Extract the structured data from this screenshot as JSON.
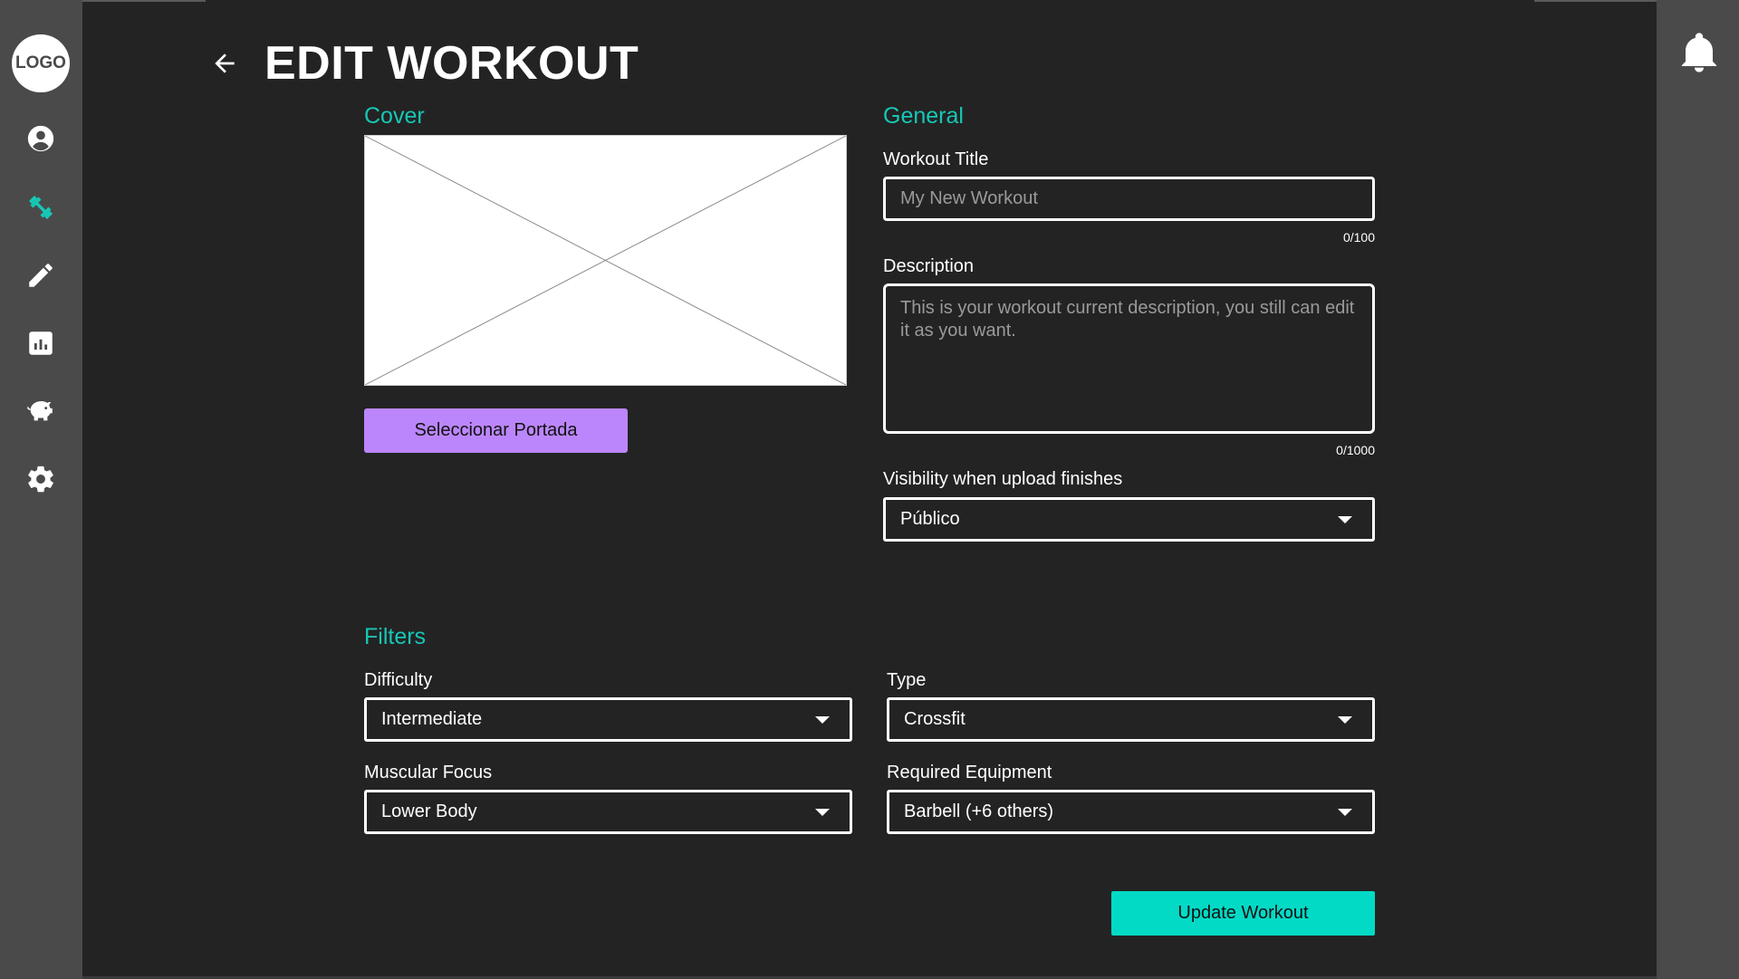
{
  "sidebar": {
    "logo_text": "LOGO",
    "items": [
      {
        "icon": "account-icon",
        "active": false
      },
      {
        "icon": "dumbbell-icon",
        "active": true
      },
      {
        "icon": "pencil-icon",
        "active": false
      },
      {
        "icon": "chart-icon",
        "active": false
      },
      {
        "icon": "piggy-bank-icon",
        "active": false
      },
      {
        "icon": "gear-icon",
        "active": false
      }
    ],
    "active_color": "#17c7b6"
  },
  "header": {
    "title": "EDIT WORKOUT",
    "back_icon": "arrow-left-icon"
  },
  "topbar": {
    "notification_icon": "bell-icon"
  },
  "cover": {
    "section_title": "Cover",
    "button_label": "Seleccionar Portada"
  },
  "general": {
    "section_title": "General",
    "title_label": "Workout Title",
    "title_placeholder": "My New Workout",
    "title_value": "",
    "title_counter": "0/100",
    "description_label": "Description",
    "description_placeholder": "This is your workout current description, you still can edit it as you want.",
    "description_value": "",
    "description_counter": "0/1000",
    "visibility_label": "Visibility when upload finishes",
    "visibility_value": "Público"
  },
  "filters": {
    "section_title": "Filters",
    "difficulty_label": "Difficulty",
    "difficulty_value": "Intermediate",
    "type_label": "Type",
    "type_value": "Crossfit",
    "muscular_label": "Muscular Focus",
    "muscular_value": "Lower Body",
    "equipment_label": "Required Equipment",
    "equipment_value": "Barbell (+6 others)"
  },
  "actions": {
    "update_label": "Update Workout"
  },
  "colors": {
    "accent": "#17c7b6",
    "primary_button": "#bb86fc",
    "update_button": "#03dac6",
    "background": "#232323",
    "sidebar": "#4a4a4a"
  }
}
